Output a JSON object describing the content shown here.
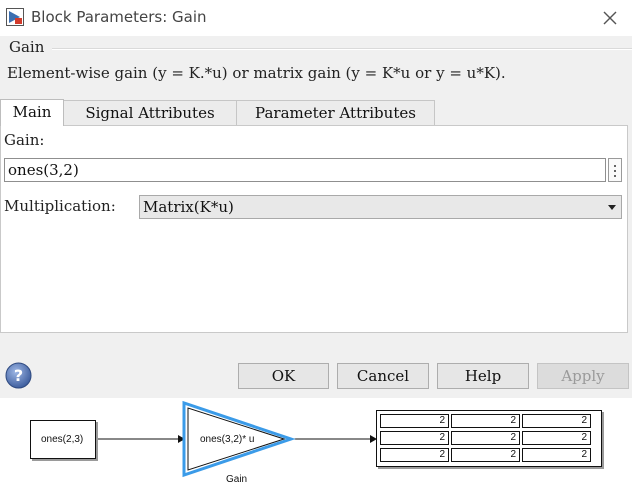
{
  "window": {
    "title": "Block Parameters: Gain",
    "icons": [
      "simulink-app-icon",
      "close-icon"
    ]
  },
  "block": {
    "group_name": "Gain",
    "description": "Element-wise gain (y = K.*u) or matrix gain (y = K*u or y = u*K)."
  },
  "tabs": [
    {
      "label": "Main",
      "active": true
    },
    {
      "label": "Signal Attributes",
      "active": false
    },
    {
      "label": "Parameter Attributes",
      "active": false
    }
  ],
  "main": {
    "gain_label": "Gain:",
    "gain_value": "ones(3,2)",
    "multiplication_label": "Multiplication:",
    "multiplication_value": "Matrix(K*u)"
  },
  "buttons": {
    "ok": "OK",
    "cancel": "Cancel",
    "help": "Help",
    "apply": "Apply"
  },
  "model": {
    "constant_block": "ones(2,3)",
    "gain_block": "ones(3,2)* u",
    "gain_block_label": "Gain",
    "display_values": [
      [
        "2",
        "2",
        "2"
      ],
      [
        "2",
        "2",
        "2"
      ],
      [
        "2",
        "2",
        "2"
      ]
    ]
  },
  "colors": {
    "selected_block": "#3b9be8",
    "dialog_bg": "#f0f0f0",
    "help_icon": "#4a6fa8"
  }
}
